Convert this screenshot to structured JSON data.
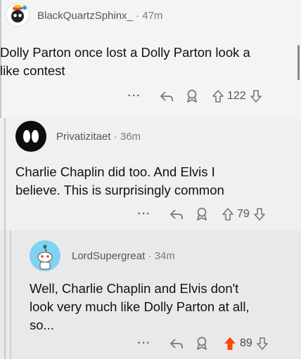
{
  "comments": [
    {
      "username": "BlackQuartzSphinx_",
      "time": "· 47m",
      "text_line1": "Dolly Parton once lost a Dolly Parton look a",
      "text_line2": "like contest",
      "more": "···",
      "votes": "122"
    },
    {
      "username": "Privatizitaet",
      "time": "· 36m",
      "text_line1": "Charlie Chaplin did too. And Elvis I",
      "text_line2": "believe. This is surprisingly common",
      "more": "···",
      "votes": "79"
    },
    {
      "username": "LordSupergreat",
      "time": "· 34m",
      "text_line1": "Well, Charlie Chaplin and Elvis don't",
      "text_line2": "look very much like Dolly Parton at all,",
      "text_line3": "so...",
      "more": "···",
      "votes": "89",
      "upvoted": true
    }
  ],
  "colors": {
    "upvote_active": "#ff4500",
    "icon_gray": "#777777"
  }
}
